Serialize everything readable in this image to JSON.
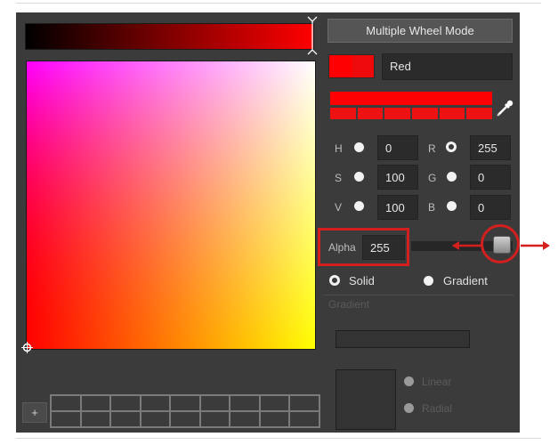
{
  "header": {
    "mode_button_label": "Multiple Wheel Mode"
  },
  "current_color": {
    "name": "Red",
    "swatch_color": "#ff0000"
  },
  "hsv": {
    "h": {
      "label": "H",
      "value": "0"
    },
    "s": {
      "label": "S",
      "value": "100"
    },
    "v": {
      "label": "V",
      "value": "100"
    }
  },
  "rgb": {
    "r": {
      "label": "R",
      "value": "255"
    },
    "g": {
      "label": "G",
      "value": "0"
    },
    "b": {
      "label": "B",
      "value": "0"
    }
  },
  "alpha": {
    "label": "Alpha",
    "value": "255"
  },
  "fill_type": {
    "solid_label": "Solid",
    "gradient_label": "Gradient",
    "selected": "Solid"
  },
  "gradient_section": {
    "title": "Gradient",
    "linear_label": "Linear",
    "radial_label": "Radial"
  },
  "swatches": {
    "add_label": "+"
  },
  "colors": {
    "accent_highlight": "#d41f1f",
    "panel_bg": "#3b3b3b"
  }
}
